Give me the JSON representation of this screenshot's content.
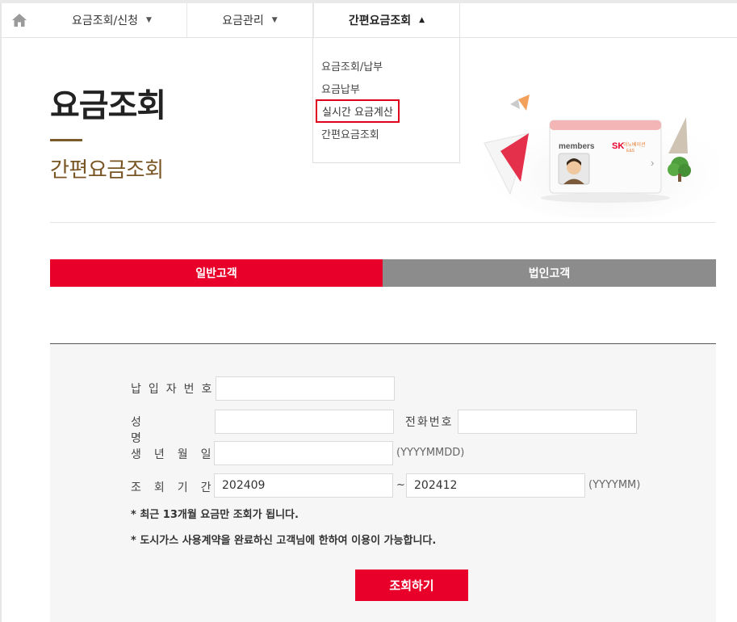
{
  "nav": {
    "items": [
      {
        "label": "요금조회/신청"
      },
      {
        "label": "요금관리"
      },
      {
        "label": "간편요금조회"
      }
    ],
    "dropdown": [
      "요금조회/납부",
      "요금납부",
      "실시간 요금계산",
      "간편요금조회"
    ]
  },
  "header": {
    "title": "요금조회",
    "subtitle": "간편요금조회",
    "card_label": "members",
    "brand": "SK",
    "brand_sub": "이노베이션",
    "brand_sub2": "E&S"
  },
  "tabs": [
    {
      "label": "일반고객",
      "active": true
    },
    {
      "label": "법인고객",
      "active": false
    }
  ],
  "form": {
    "payer_label": "납입자번호",
    "name_label": "성명",
    "phone_label": "전화번호",
    "birth_label": "생년월일",
    "birth_hint": "(YYYYMMDD)",
    "period_label": "조회기간",
    "period_from": "202409",
    "period_sep": "~",
    "period_to": "202412",
    "period_hint": "(YYYYMM)",
    "note1": "* 최근 13개월 요금만 조회가 됩니다.",
    "note2": "* 도시가스 사용계약을 완료하신 고객님에 한하여 이용이 가능합니다.",
    "submit_label": "조회하기"
  },
  "colors": {
    "accent": "#e8002b",
    "brown": "#7a5524",
    "tab_inactive": "#8c8c8c"
  }
}
